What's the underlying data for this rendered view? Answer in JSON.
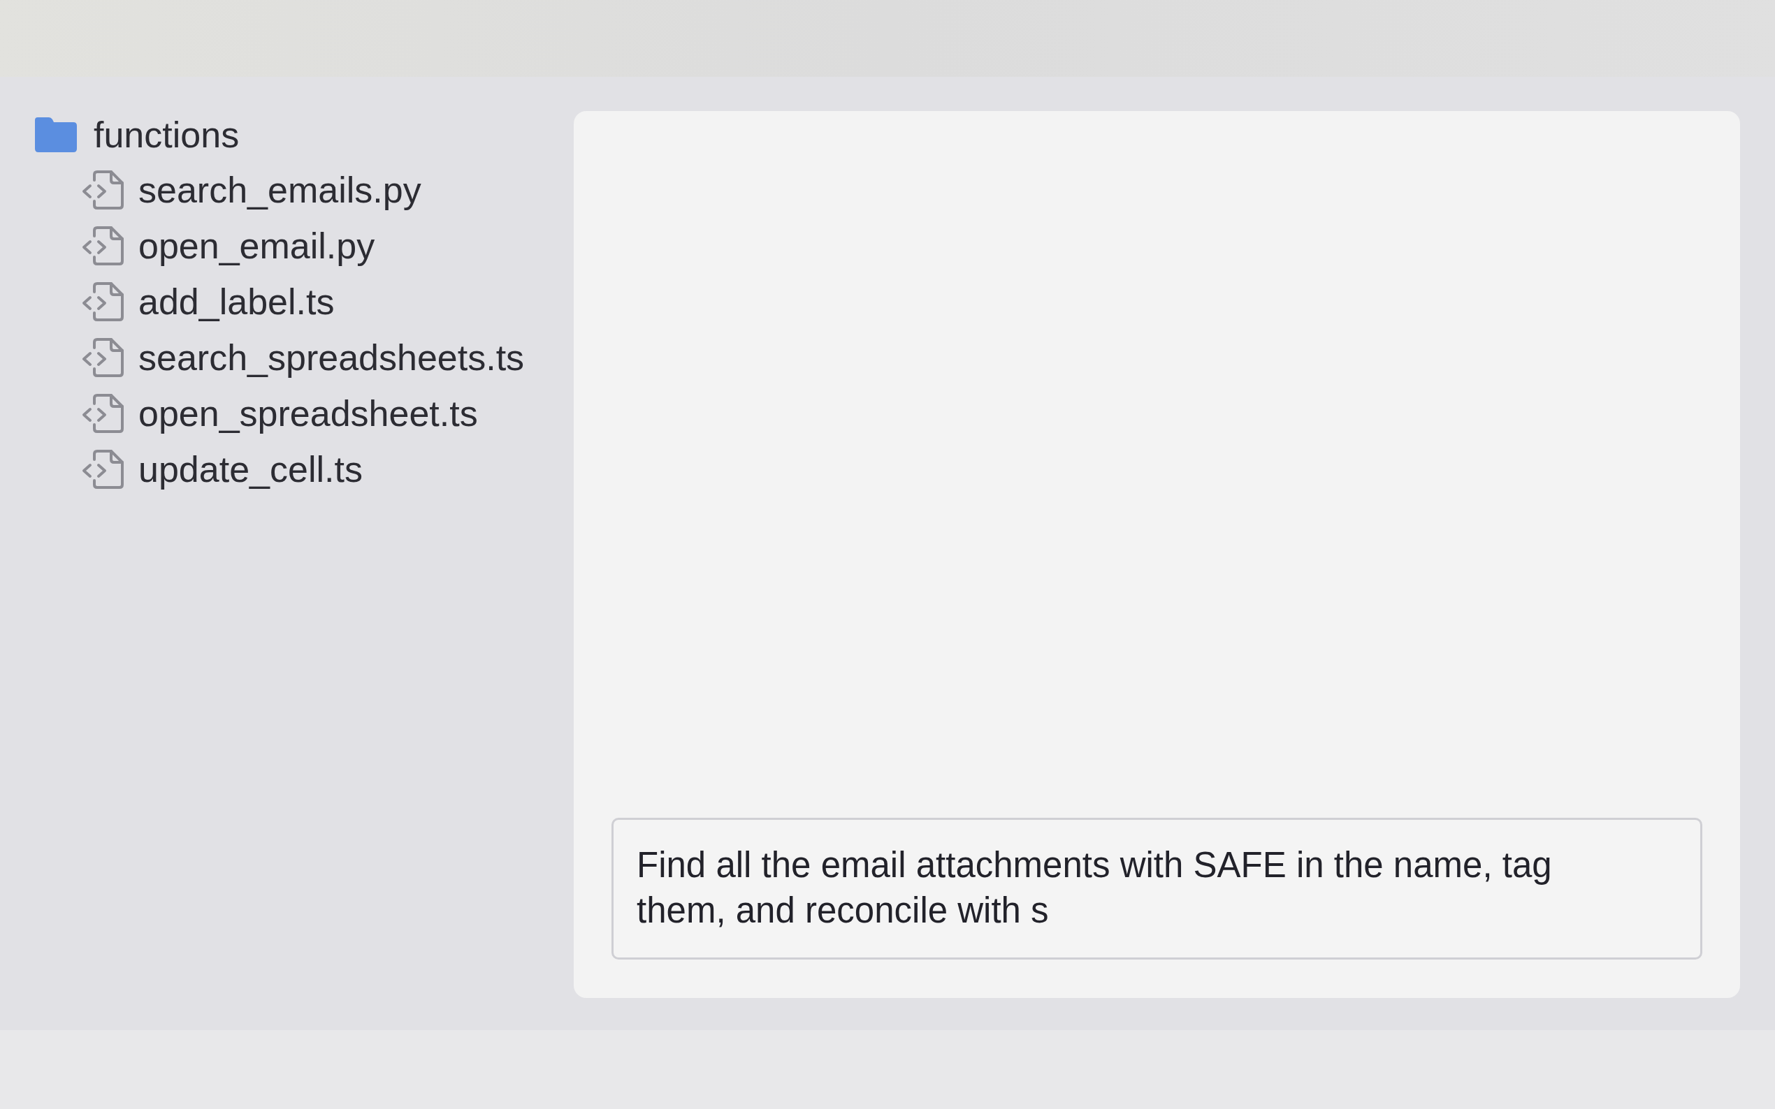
{
  "sidebar": {
    "folder": {
      "name": "functions",
      "children": [
        {
          "name": "search_emails.py"
        },
        {
          "name": "open_email.py"
        },
        {
          "name": "add_label.ts"
        },
        {
          "name": "search_spreadsheets.ts"
        },
        {
          "name": "open_spreadsheet.ts"
        },
        {
          "name": "update_cell.ts"
        }
      ]
    }
  },
  "prompt": {
    "value": "Find all the email attachments with SAFE in the name, tag them, and reconcile with s"
  }
}
